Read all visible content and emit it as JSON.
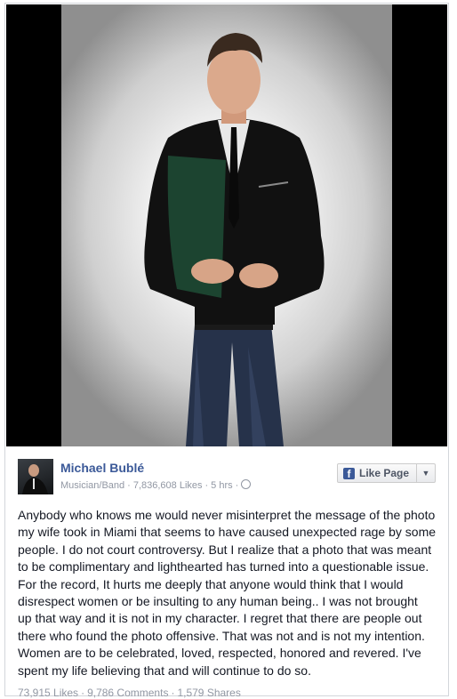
{
  "page": {
    "name": "Michael Bublé",
    "category": "Musician/Band",
    "likes_count": "7,836,608 Likes",
    "time": "5 hrs",
    "privacy_icon": "globe-icon"
  },
  "like_button": {
    "label": "Like Page",
    "icon": "facebook-icon",
    "dropdown_icon": "chevron-down-icon"
  },
  "post": {
    "text": "Anybody who knows me would never misinterpret the message of the photo\nmy wife took in Miami that seems to have caused unexpected rage by some\npeople. I do not court controversy. But I realize that a photo that was meant\nto be complimentary and lighthearted has turned into a questionable issue.\nFor the record, It hurts me deeply that anyone would think that I would\ndisrespect women or be insulting to any human being.. I was not brought\nup that way and it is not in my character. I regret that there are people out\nthere who found the photo offensive. That was not and is not my intention.\nWomen are to be celebrated, loved, respected, honored and revered. I've\nspent my life believing that and will continue to do so."
  },
  "stats": {
    "likes": "73,915 Likes",
    "comments": "9,786 Comments",
    "shares": "1,579 Shares"
  },
  "colors": {
    "link_blue": "#3b5998",
    "meta_gray": "#9197a3",
    "text": "#141823"
  }
}
